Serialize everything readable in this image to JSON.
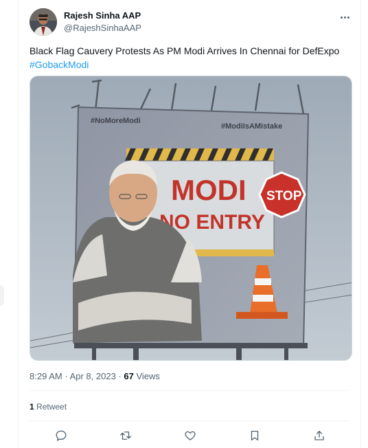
{
  "author": {
    "name": "Rajesh Sinha AAP",
    "handle": "@RajeshSinhaAAP",
    "avatar_icon": "user-avatar"
  },
  "tweet": {
    "text": "Black Flag Cauvery Protests As PM Modi Arrives In Chennai for DefExpo",
    "hashtag": "#GobackModi"
  },
  "media": {
    "billboard_tag_left": "#NoMoreModi",
    "billboard_tag_right": "#ModiIsAMistake",
    "headline_line1": "MODI",
    "headline_line2": "NO ENTRY",
    "stop_sign_text": "STOP"
  },
  "meta": {
    "time": "8:29 AM",
    "separator1": "·",
    "date": "Apr 8, 2023",
    "separator2": "·",
    "views_count": "67",
    "views_label": "Views"
  },
  "stats": {
    "retweets_count": "1",
    "retweets_label": "Retweet"
  },
  "actions": {
    "reply": "reply-icon",
    "retweet": "retweet-icon",
    "like": "heart-icon",
    "bookmark": "bookmark-icon",
    "share": "share-icon"
  },
  "colors": {
    "link": "#1d9bf0",
    "text": "#0f1419",
    "secondary": "#536471",
    "border": "#eff3f4"
  }
}
